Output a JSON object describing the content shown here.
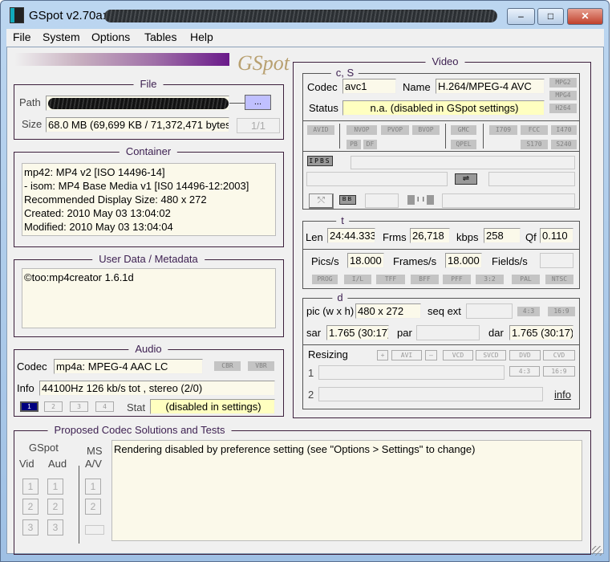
{
  "window": {
    "title": "GSpot v2.70a:",
    "min": "–",
    "max": "□",
    "close": "✕"
  },
  "menu": [
    "File",
    "System",
    "Options",
    "Tables",
    "Help"
  ],
  "logo": "GSpot",
  "file": {
    "legend": "File",
    "path_label": "Path",
    "browse": "...",
    "size_label": "Size",
    "size": "68.0 MB (69,699 KB / 71,372,471 bytes)",
    "count": "1/1"
  },
  "container": {
    "legend": "Container",
    "lines": [
      "mp42: MP4 v2 [ISO 14496-14]",
      "- isom: MP4  Base Media v1 [IS0 14496-12:2003]",
      "Recommended Display Size: 480 x 272",
      "Created:  2010 May 03   13:04:02",
      "Modified: 2010 May 03   13:04:04"
    ]
  },
  "userdata": {
    "legend": "User Data / Metadata",
    "text": "©too:mp4creator 1.6.1d"
  },
  "audio": {
    "legend": "Audio",
    "codec_label": "Codec",
    "codec": "mp4a: MPEG-4 AAC LC",
    "cbr": "CBR",
    "vbr": "VBR",
    "info_label": "Info",
    "info": "44100Hz  126 kb/s tot , stereo (2/0)",
    "streams": [
      "1",
      "2",
      "3",
      "4"
    ],
    "stat_label": "Stat",
    "stat": "(disabled in settings)"
  },
  "video": {
    "legend": "Video",
    "cs": {
      "legend": "c, S",
      "codec_label": "Codec",
      "codec": "avc1",
      "name_label": "Name",
      "name": "H.264/MPEG-4 AVC",
      "status_label": "Status",
      "status": "n.a. (disabled in GSpot settings)",
      "fmt": [
        "MPG2",
        "MPG4",
        "H264"
      ]
    },
    "flags": {
      "avid": "AVID",
      "nvop": "NVOP",
      "pvop": "PVOP",
      "bvop": "BVOP",
      "pb": "PB",
      "df": "DF",
      "gmc": "GMC",
      "qpel": "QPEL",
      "i709": "I709",
      "fcc": "FCC",
      "i470": "I470",
      "s170": "S170",
      "s240": "S240"
    },
    "frames": {
      "ipbs": "IPBS",
      "bb": "BB",
      "ii": "I  I"
    },
    "t": {
      "legend": "t",
      "len_label": "Len",
      "len": "24:44.333",
      "frms_label": "Frms",
      "frms": "26,718",
      "kbps_label": "kbps",
      "kbps": "258",
      "qf_label": "Qf",
      "qf": "0.110",
      "pics_label": "Pics/s",
      "pics": "18.000",
      "fps_label": "Frames/s",
      "fps": "18.000",
      "fields_label": "Fields/s",
      "fields": "",
      "modes": [
        "PROG",
        "I/L",
        "TFF",
        "BFF",
        "PFF",
        "3:2",
        "PAL",
        "NTSC"
      ]
    },
    "d": {
      "legend": "d",
      "pic_label": "pic (w x h)",
      "pic": "480 x 272",
      "seq_label": "seq ext",
      "seq": "",
      "r43": "4:3",
      "r169": "16:9",
      "sar_label": "sar",
      "sar": "1.765 (30:17)",
      "par_label": "par",
      "par": "",
      "dar_label": "dar",
      "dar": "1.765 (30:17)"
    },
    "resizing": {
      "label": "Resizing",
      "plus": "+",
      "avi": "AVI",
      "minus": "–",
      "vcd": "VCD",
      "svcd": "SVCD",
      "dvd": "DVD",
      "cvd": "CVD",
      "row1": "1",
      "row2": "2",
      "r43": "4:3",
      "r169": "16:9",
      "info": "info"
    }
  },
  "proposed": {
    "legend": "Proposed Codec Solutions and Tests",
    "gspot": "GSpot",
    "vid": "Vid",
    "aud": "Aud",
    "ms": "MS",
    "av": "A/V",
    "n1": "1",
    "n2": "2",
    "n3": "3",
    "text": "Rendering disabled by preference setting (see \"Options > Settings\" to change)"
  },
  "colors": {
    "accent": "#3c1f50",
    "field": "#fbf9ea",
    "status": "#ffffc0",
    "browse": "#c0c0ff",
    "selected_stream": "#000080"
  }
}
